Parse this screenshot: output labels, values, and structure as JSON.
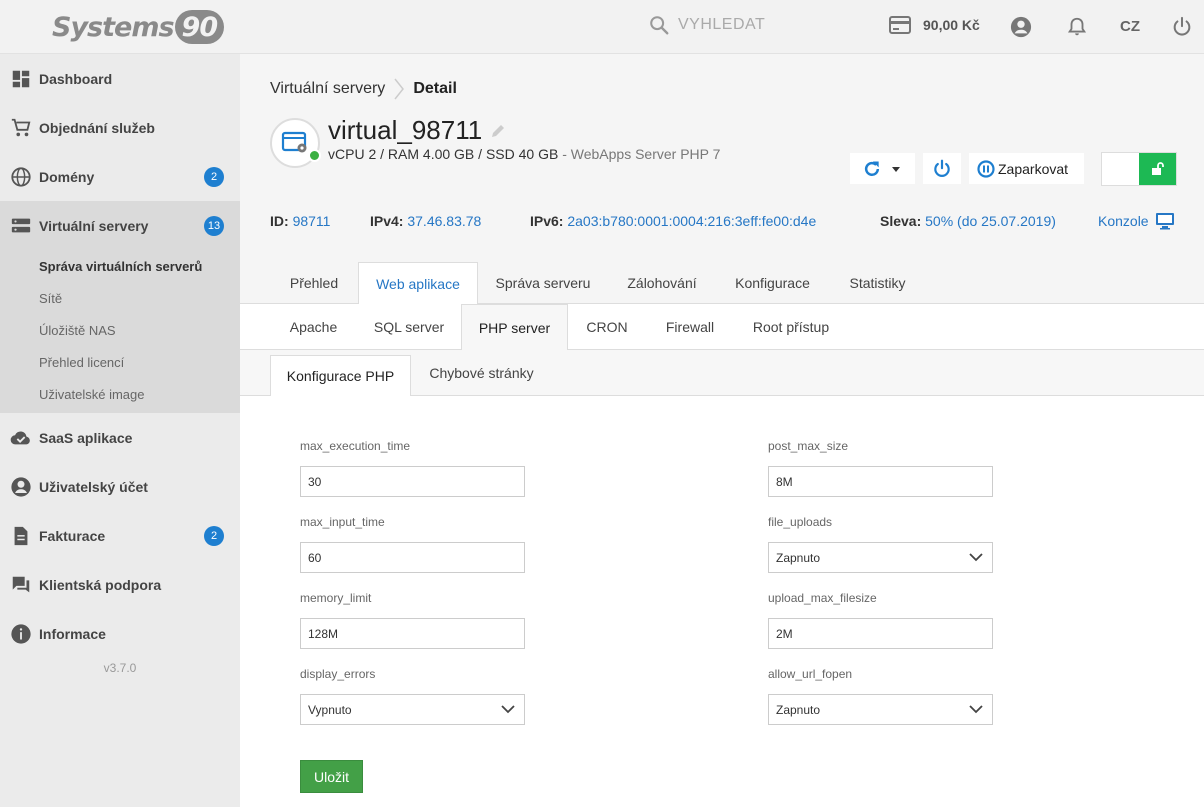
{
  "header": {
    "logo_text": "Systems",
    "logo_num": "90",
    "search_placeholder": "VYHLEDAT",
    "credit": "90,00 Kč",
    "language": "CZ"
  },
  "sidebar": {
    "items": [
      {
        "label": "Dashboard",
        "icon": "dashboard-icon"
      },
      {
        "label": "Objednání služeb",
        "icon": "cart-icon"
      },
      {
        "label": "Domény",
        "icon": "globe-icon",
        "badge": "2"
      },
      {
        "label": "Virtuální servery",
        "icon": "server-icon",
        "badge": "13"
      },
      {
        "label": "SaaS aplikace",
        "icon": "cloud-check-icon"
      },
      {
        "label": "Uživatelský účet",
        "icon": "account-icon"
      },
      {
        "label": "Fakturace",
        "icon": "document-icon",
        "badge": "2"
      },
      {
        "label": "Klientská podpora",
        "icon": "chat-icon"
      },
      {
        "label": "Informace",
        "icon": "info-icon"
      }
    ],
    "subitems": [
      "Správa virtuálních serverů",
      "Sítě",
      "Úložiště NAS",
      "Přehled licencí",
      "Uživatelské image"
    ],
    "version": "v3.7.0"
  },
  "breadcrumb": {
    "parent": "Virtuální servery",
    "current": "Detail"
  },
  "server": {
    "name": "virtual_98711",
    "spec": "vCPU 2 / RAM 4.00 GB / SSD 40 GB",
    "spec_suffix": " - WebApps Server PHP 7",
    "park_label": "Zaparkovat"
  },
  "info": {
    "id_label": "ID:",
    "id_value": "98711",
    "ipv4_label": "IPv4:",
    "ipv4_value": "37.46.83.78",
    "ipv6_label": "IPv6:",
    "ipv6_value": "2a03:b780:0001:0004:216:3eff:fe00:d4e",
    "discount_label": "Sleva:",
    "discount_value": "50% (do 25.07.2019)",
    "console_label": "Konzole"
  },
  "tabs_main": [
    "Přehled",
    "Web aplikace",
    "Správa serveru",
    "Zálohování",
    "Konfigurace",
    "Statistiky"
  ],
  "tabs_sub": [
    "Apache",
    "SQL server",
    "PHP server",
    "CRON",
    "Firewall",
    "Root přístup"
  ],
  "tabs_php": [
    "Konfigurace PHP",
    "Chybové stránky"
  ],
  "form": {
    "fields_left": [
      {
        "label": "max_execution_time",
        "value": "30"
      },
      {
        "label": "max_input_time",
        "value": "60"
      },
      {
        "label": "memory_limit",
        "value": "128M"
      },
      {
        "label": "display_errors",
        "value": "Vypnuto"
      }
    ],
    "fields_right": [
      {
        "label": "post_max_size",
        "value": "8M"
      },
      {
        "label": "file_uploads",
        "value": "Zapnuto"
      },
      {
        "label": "upload_max_filesize",
        "value": "2M"
      },
      {
        "label": "allow_url_fopen",
        "value": "Zapnuto"
      }
    ],
    "save_label": "Uložit"
  },
  "colors": {
    "accent": "#2677c5",
    "badge": "#1e7fd0",
    "success": "#43a047",
    "status_online": "#3cb043"
  }
}
